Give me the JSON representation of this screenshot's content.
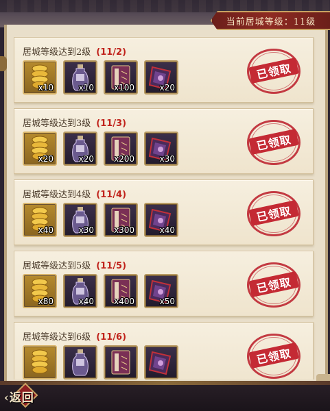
{
  "header": {
    "current_level_text": "当前居城等级：11级"
  },
  "rewards": [
    {
      "title": "居城等级达到2级",
      "progress": "(11/2)",
      "quantities": [
        "x10",
        "x10",
        "x100",
        "x20"
      ],
      "status": "已领取"
    },
    {
      "title": "居城等级达到3级",
      "progress": "(11/3)",
      "quantities": [
        "x20",
        "x20",
        "x200",
        "x30"
      ],
      "status": "已领取"
    },
    {
      "title": "居城等级达到4级",
      "progress": "(11/4)",
      "quantities": [
        "x40",
        "x30",
        "x300",
        "x40"
      ],
      "status": "已领取"
    },
    {
      "title": "居城等级达到5级",
      "progress": "(11/5)",
      "quantities": [
        "x80",
        "x40",
        "x400",
        "x50"
      ],
      "status": "已领取"
    },
    {
      "title": "居城等级达到6级",
      "progress": "(11/6)",
      "quantities": [
        "",
        "",
        "",
        ""
      ],
      "status": "已领取"
    }
  ],
  "item_icons": [
    "gold-ingot-icon",
    "potion-bottle-icon",
    "scroll-book-icon",
    "purple-banner-icon"
  ],
  "footer": {
    "back_label": "返回"
  },
  "colors": {
    "accent_red": "#c0221b",
    "stamp_red": "#c42a34",
    "card_bg": "#f6efdf",
    "frame_gold": "#c9a262"
  }
}
